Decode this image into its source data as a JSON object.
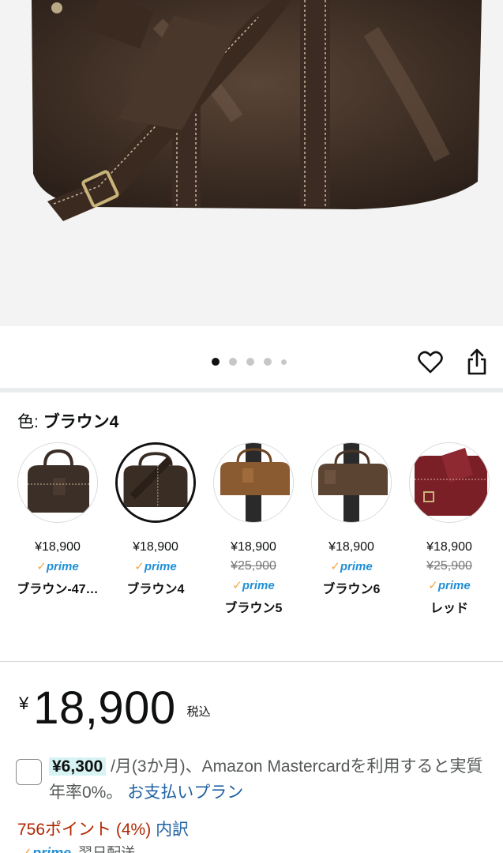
{
  "carousel": {
    "total_images": 5,
    "active_index": 0
  },
  "color": {
    "label": "色:",
    "selected_name": "ブラウン4"
  },
  "variants": [
    {
      "price": "¥18,900",
      "prime": "prime",
      "name": "ブラウン-47…",
      "strike": "",
      "selected": false
    },
    {
      "price": "¥18,900",
      "prime": "prime",
      "name": "ブラウン4",
      "strike": "",
      "selected": true
    },
    {
      "price": "¥18,900",
      "strike": "¥25,900",
      "prime": "prime",
      "name": "ブラウン5",
      "selected": false
    },
    {
      "price": "¥18,900",
      "prime": "prime",
      "name": "ブラウン6",
      "strike": "",
      "selected": false
    },
    {
      "price": "¥18,900",
      "strike": "¥25,900",
      "prime": "prime",
      "name": "レッド",
      "selected": false
    }
  ],
  "price": {
    "yen": "¥",
    "amount": "18,900",
    "tax": "税込"
  },
  "installment": {
    "monthly": "¥6,300",
    "text": " /月(3か月)、Amazon Mastercardを利用すると実質年率0%。",
    "link": "お支払いプラン"
  },
  "points": {
    "text": "756ポイント (4%)",
    "link": "内訳"
  },
  "prime_delivery": {
    "prime": "prime",
    "text": "翌日配送"
  },
  "colors": {
    "link": "#2162a1",
    "price_red": "#b12704",
    "prime_blue": "#1f8fd6",
    "prime_check": "#f3a847"
  }
}
